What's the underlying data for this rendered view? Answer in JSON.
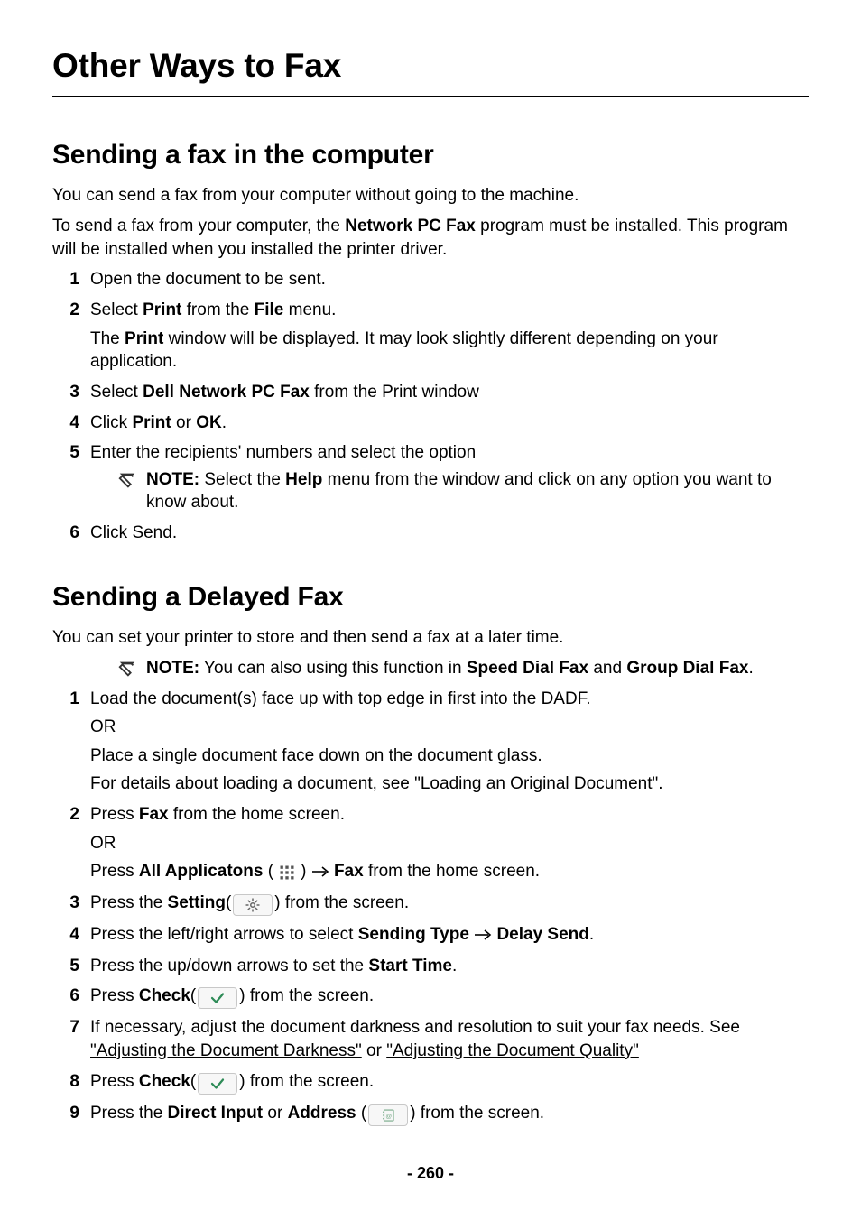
{
  "page_title": "Other Ways to Fax",
  "section1": {
    "title": "Sending a fax in the computer",
    "intro1": "You can send a fax from your computer without going to the machine.",
    "intro2_a": "To send a fax from your computer, the ",
    "intro2_b": "Network PC Fax",
    "intro2_c": " program must be installed. This program will be installed when you installed the printer driver.",
    "step1": "Open the document to be sent.",
    "step2_a": "Select ",
    "step2_b": "Print",
    "step2_c": " from the ",
    "step2_d": "File",
    "step2_e": " menu.",
    "step2_body_a": "The ",
    "step2_body_b": "Print",
    "step2_body_c": " window will be displayed. It may look slightly different depending on your application.",
    "step3_a": "Select ",
    "step3_b": "Dell Network PC Fax",
    "step3_c": " from the Print window",
    "step4_a": "Click ",
    "step4_b": "Print",
    "step4_c": " or ",
    "step4_d": "OK",
    "step4_e": ".",
    "step5": "Enter the recipients' numbers and select the option",
    "note_label": "NOTE:",
    "note_a": " Select the ",
    "note_b": "Help",
    "note_c": " menu from the window and click on any option you want to know about.",
    "step6": "Click Send."
  },
  "section2": {
    "title": "Sending a Delayed Fax",
    "intro": "You can set your printer to store and then send a fax at a later time.",
    "note_label": "NOTE:",
    "note_a": " You can also using this function in ",
    "note_b": "Speed Dial Fax",
    "note_c": " and ",
    "note_d": "Group Dial Fax",
    "note_e": ".",
    "step1_a": "Load the document(s) face up with top edge in first into the DADF.",
    "step1_or": "OR",
    "step1_b": "Place a single document face down on the document glass.",
    "step1_c_a": "For details about loading a document, see ",
    "step1_c_link": "\"Loading an Original Document\"",
    "step1_c_b": ".",
    "step2_a": "Press ",
    "step2_b": "Fax",
    "step2_c": " from the home screen.",
    "step2_or": "OR",
    "step2_d_a": "Press ",
    "step2_d_b": "All Applicatons",
    "step2_d_c": " (",
    "step2_d_d": ") ",
    "step2_d_e": " Fax",
    "step2_d_f": " from the home screen.",
    "step3_a": "Press the ",
    "step3_b": "Setting",
    "step3_c": "(",
    "step3_d": ") from the screen.",
    "step4_a": "Press the left/right arrows to select ",
    "step4_b": "Sending Type ",
    "step4_c": " Delay Send",
    "step4_d": ".",
    "step5_a": "Press the up/down arrows to set the ",
    "step5_b": "Start Time",
    "step5_c": ".",
    "step6_a": "Press ",
    "step6_b": "Check",
    "step6_c": "(",
    "step6_d": ") from the screen.",
    "step7_a": "If necessary, adjust the document darkness and resolution to suit your fax needs. See ",
    "step7_link1": "\"Adjusting the Document Darkness\"",
    "step7_b": " or ",
    "step7_link2": "\"Adjusting the Document Quality\"",
    "step8_a": "Press ",
    "step8_b": "Check",
    "step8_c": "(",
    "step8_d": ") from the screen.",
    "step9_a": "Press the ",
    "step9_b": "Direct Input",
    "step9_c": " or ",
    "step9_d": "Address",
    "step9_e": " (",
    "step9_f": ") from the screen."
  },
  "page_number": "260"
}
